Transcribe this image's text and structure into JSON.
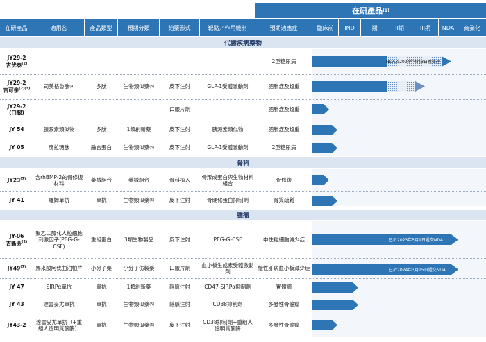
{
  "banner": {
    "title": "在研產品",
    "sup": "(1)"
  },
  "headers": [
    "在研產品",
    "適用名",
    "產品類型",
    "預期分類",
    "給藥形式",
    "靶點／作用機制",
    "預期適應症",
    "臨床前",
    "IND",
    "I期",
    "II期",
    "III期",
    "NDA",
    "商業化"
  ],
  "sections": {
    "metabolic": "代謝疾病藥物",
    "orthopedics": "骨科",
    "oncology": "腫瘤"
  },
  "rows": {
    "jy29_2a": {
      "code": "JY29-2",
      "name": "吉优泰",
      "sup": "(2)",
      "indication": "2型糖尿病",
      "note": "NDA於2024年4月3日獲受理"
    },
    "jy29_2b": {
      "code": "JY29-2",
      "name": "吉可亲",
      "sup": "(2)(3)",
      "indication": "肥胖症及超重"
    },
    "jy29_2c": {
      "code": "JY29-2",
      "name": "(口服)",
      "route": "口服片劑",
      "indication": "肥胖症及超重"
    },
    "jy29_shared": {
      "generic": "司美格魯肽",
      "generic_sup": "(4)",
      "type": "多肽",
      "category": "生物類似藥",
      "category_sup": "(5)",
      "route": "皮下注射",
      "target": "GLP-1受體激動劑"
    },
    "jy54": {
      "code": "JY 54",
      "generic": "胰澱素類似物",
      "type": "多肽",
      "category": "1類創新藥",
      "route": "皮下注射",
      "target": "胰澱素類似物",
      "indication": "肥胖症及超重"
    },
    "jy05": {
      "code": "JY 05",
      "generic": "度拉糖肽",
      "type": "融合蛋白",
      "category": "生物類似藥",
      "category_sup": "(5)",
      "route": "皮下注射",
      "target": "GLP-1受體激動劑",
      "indication": "2型糖尿病"
    },
    "jy23": {
      "code": "JY23",
      "code_sup": "(7)",
      "generic": "含rhBMP-2的骨修復材料",
      "type": "藥械組合",
      "category": "藥械組合",
      "route": "骨科植入",
      "target": "骨形成蛋白與生物材料組合",
      "indication": "骨修復"
    },
    "jy41": {
      "code": "JY 41",
      "generic": "羅姆單抗",
      "type": "單抗",
      "category": "生物類似藥",
      "category_sup": "(5)",
      "route": "皮下注射",
      "target": "骨硬化蛋白抑制劑",
      "indication": "骨質疏鬆"
    },
    "jy06": {
      "code": "JY-06",
      "name": "吉新芬",
      "sup": "(2)",
      "generic": "聚乙二醇化人粒細胞刺激因子(PEG-G-CSF)",
      "type": "重組蛋白",
      "category": "3類生物製品",
      "route": "皮下注射",
      "target": "PEG-G-CSF",
      "indication": "中性粒細胞減少症",
      "note": "已於2023年5月9日遞交NDA"
    },
    "jy49": {
      "code": "JY49",
      "code_sup": "(7)",
      "generic": "馬來酸阿伐曲泊帕片",
      "type": "小分子藥",
      "category": "小分子仿製藥",
      "route": "口服片劑",
      "target": "血小板生成素受體激動劑",
      "indication": "慢性肝病血小板減少症",
      "note": "已於2024年3月15日遞交NDA"
    },
    "jy47": {
      "code": "JY 47",
      "generic": "SIRPα單抗",
      "type": "單抗",
      "category": "1類創新藥",
      "route": "靜脈注射",
      "target": "CD47-SIRPα抑制劑",
      "indication": "實體瘤"
    },
    "jy43": {
      "code": "JY 43",
      "generic": "達雷妥尤單抗",
      "type": "單抗",
      "category": "生物類似藥",
      "category_sup": "(5)",
      "route": "靜脈注射",
      "target": "CD38抑制劑",
      "indication": "多發性骨髓瘤"
    },
    "jy43_2": {
      "code": "JY43-2",
      "generic": "達雷妥尤單抗（+重組人透明質酸酶）",
      "type": "單抗",
      "category": "生物類似藥",
      "category_sup": "(6)",
      "route": "皮下注射",
      "target": "CD38抑制劑+重組人透明質酸酶",
      "indication": "多發性骨髓瘤"
    }
  },
  "colors": {
    "header": "#2e75b6",
    "section": "#dbe5f1",
    "bar": "#2e75b6",
    "bar_dotted": "#6b8fbf"
  }
}
